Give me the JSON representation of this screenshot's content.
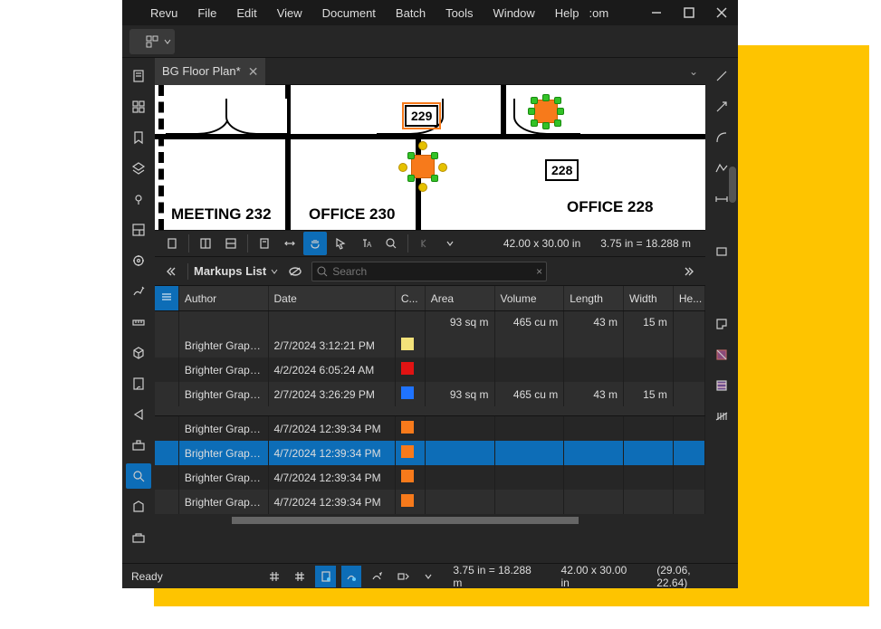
{
  "menu": {
    "items": [
      "Revu",
      "File",
      "Edit",
      "View",
      "Document",
      "Batch",
      "Tools",
      "Window",
      "Help"
    ],
    "extra": ":om"
  },
  "tab": {
    "name": "BG Floor Plan*"
  },
  "canvas": {
    "rooms": [
      {
        "label": "MEETING  232"
      },
      {
        "label": "OFFICE  230"
      },
      {
        "label": "OFFICE  228"
      }
    ],
    "tags": [
      {
        "id": "229",
        "selected": true
      },
      {
        "id": "228",
        "selected": false
      }
    ]
  },
  "canvastb": {
    "size": "42.00 x 30.00 in",
    "scale": "3.75 in = 18.288 m"
  },
  "markups": {
    "title": "Markups List",
    "search_placeholder": "Search",
    "cols": {
      "author": "Author",
      "date": "Date",
      "color": "C...",
      "area": "Area",
      "volume": "Volume",
      "length": "Length",
      "width": "Width",
      "height": "He..."
    },
    "summary": {
      "area": "93 sq m",
      "volume": "465 cu m",
      "length": "43 m",
      "width": "15 m"
    },
    "rows": [
      {
        "author": "Brighter Graph...",
        "date": "2/7/2024 3:12:21 PM",
        "color": "#f3e27a",
        "area": "",
        "volume": "",
        "length": "",
        "width": "",
        "sel": false
      },
      {
        "author": "Brighter Graph...",
        "date": "4/2/2024 6:05:24 AM",
        "color": "#e11313",
        "area": "",
        "volume": "",
        "length": "",
        "width": "",
        "sel": false
      },
      {
        "author": "Brighter Graph...",
        "date": "2/7/2024 3:26:29 PM",
        "color": "#1f73ff",
        "area": "93 sq m",
        "volume": "465 cu m",
        "length": "43 m",
        "width": "15 m",
        "sel": false
      },
      {
        "author": "Brighter Graph...",
        "date": "4/7/2024 12:39:34 PM",
        "color": "#f77a1b",
        "area": "",
        "volume": "",
        "length": "",
        "width": "",
        "sel": false
      },
      {
        "author": "Brighter Graph...",
        "date": "4/7/2024 12:39:34 PM",
        "color": "#f77a1b",
        "area": "",
        "volume": "",
        "length": "",
        "width": "",
        "sel": true
      },
      {
        "author": "Brighter Graph...",
        "date": "4/7/2024 12:39:34 PM",
        "color": "#f77a1b",
        "area": "",
        "volume": "",
        "length": "",
        "width": "",
        "sel": false
      },
      {
        "author": "Brighter Graph...",
        "date": "4/7/2024 12:39:34 PM",
        "color": "#f77a1b",
        "area": "",
        "volume": "",
        "length": "",
        "width": "",
        "sel": false
      }
    ]
  },
  "statusbar": {
    "ready": "Ready",
    "scale": "3.75 in = 18.288 m",
    "size": "42.00 x 30.00 in",
    "coords": "(29.06, 22.64)"
  }
}
